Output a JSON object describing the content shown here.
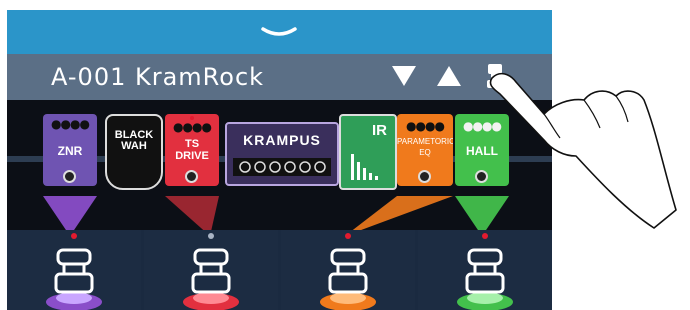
{
  "patch": {
    "name": "A-001 KramRock"
  },
  "header_icons": [
    "triangle-down-icon",
    "triangle-up-icon",
    "footswitch-icon"
  ],
  "effects": [
    {
      "label": "ZNR",
      "color": "#6f54b2"
    },
    {
      "label": "BLACK\nWAH",
      "color": "#111111"
    },
    {
      "label": "TS\nDRIVE",
      "color": "#e2303f"
    },
    {
      "label": "KRAMPUS",
      "color": "#3a2f5c"
    },
    {
      "label": "IR",
      "color": "#2f9e58"
    },
    {
      "label": "PARAMETORIC\nEQ",
      "color": "#f07a1c"
    },
    {
      "label": "HALL",
      "color": "#43c04c"
    }
  ],
  "footswitches": [
    {
      "color": "#8a4ec9",
      "led": "#e21b2f"
    },
    {
      "color": "#e2303f",
      "led": "#a9b4c4"
    },
    {
      "color": "#f07a1c",
      "led": "#e21b2f"
    },
    {
      "color": "#43c04c",
      "led": "#e21b2f"
    }
  ]
}
